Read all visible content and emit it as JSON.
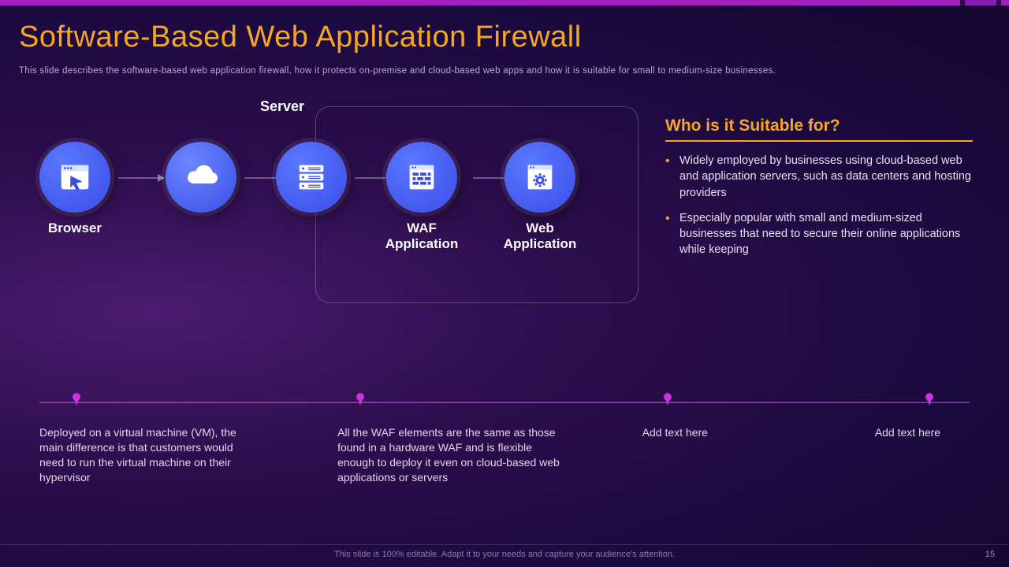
{
  "title": "Software-Based Web Application Firewall",
  "subtitle": "This slide describes the software-based web application firewall, how it protects on-premise and cloud-based web apps and how it is suitable for small to medium-size businesses.",
  "server_label": "Server",
  "nodes": {
    "browser": "Browser",
    "waf": "WAF Application",
    "web": "Web Application"
  },
  "side": {
    "heading": "Who is it Suitable for?",
    "bullets": [
      "Widely employed by businesses using cloud-based web and application servers, such as data centers and hosting providers",
      "Especially popular with small and medium-sized businesses that need to secure their online applications while keeping"
    ]
  },
  "timeline": [
    "Deployed on a virtual machine (VM), the main difference is that customers would need to run the virtual machine on their hypervisor",
    "All the WAF elements are the same as those found in a hardware WAF and is flexible enough to deploy it even on cloud-based web applications or servers",
    "Add text here",
    "Add text here"
  ],
  "footer": "This slide is 100% editable. Adapt it to your needs and capture your audience's attention.",
  "page": "15"
}
